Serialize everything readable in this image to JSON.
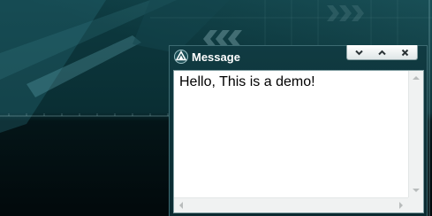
{
  "window": {
    "title": "Message",
    "icon": "app-logo-icon",
    "controls": {
      "minimize_icon": "chevron-down-icon",
      "maximize_icon": "chevron-up-icon",
      "close_icon": "close-icon"
    }
  },
  "message": {
    "text": "Hello, This is a demo!"
  },
  "colors": {
    "desktop": "#0a2e33",
    "window_frame": "#103b42",
    "title_text": "#ffffff",
    "content_bg": "#ffffff"
  }
}
